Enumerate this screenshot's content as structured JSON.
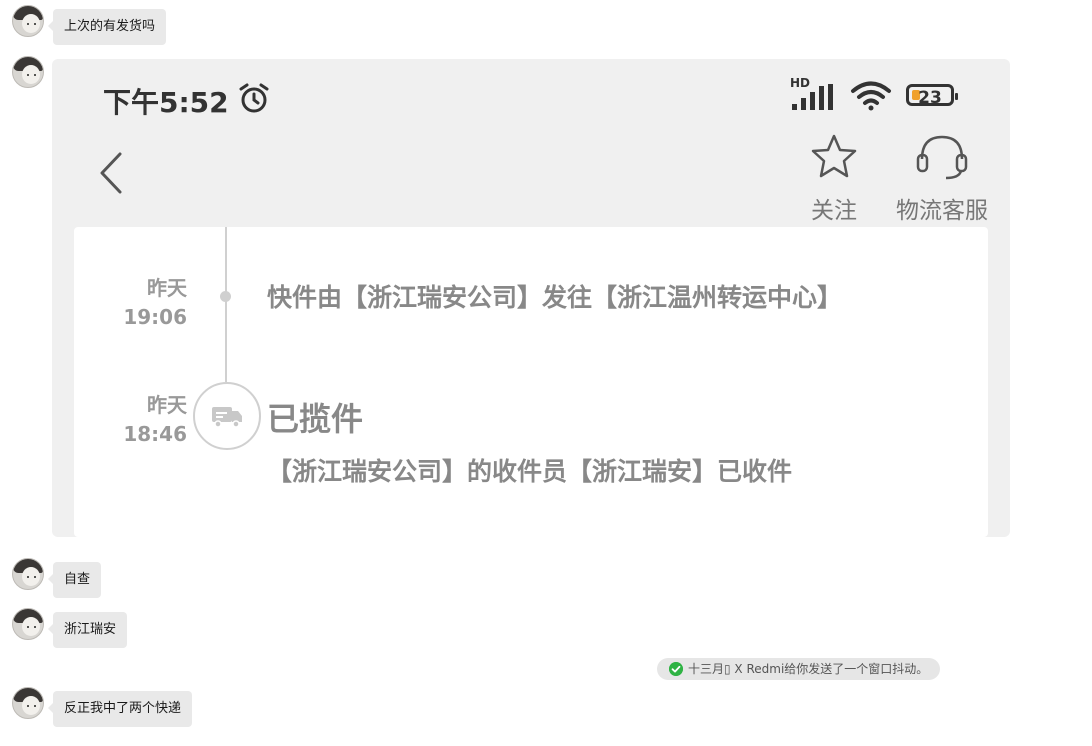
{
  "messages": [
    {
      "text": "上次的有发货吗"
    },
    {
      "text": "自查"
    },
    {
      "text": "浙江瑞安"
    },
    {
      "text": "反正我中了两个快递"
    }
  ],
  "screenshot": {
    "status_bar": {
      "time": "下午5:52",
      "network": "HD",
      "battery": "23"
    },
    "actions": {
      "follow_label": "关注",
      "service_label": "物流客服"
    },
    "timeline": [
      {
        "day": "昨天",
        "time": "19:06",
        "text": "快件由【浙江瑞安公司】发往【浙江温州转运中心】"
      },
      {
        "day": "昨天",
        "time": "18:46",
        "title": "已揽件",
        "text": "【浙江瑞安公司】的收件员【浙江瑞安】已收件"
      }
    ]
  },
  "system_notice": {
    "text": "十三月\u0000 X Redmi给你发送了一个窗口抖动。",
    "display": "十三月▯ X Redmi给你发送了一个窗口抖动。"
  },
  "colors": {
    "bubble": "#e9e9e9",
    "card": "#f0f0f0",
    "battery_fill": "#f0a12b",
    "check": "#2fb344"
  }
}
